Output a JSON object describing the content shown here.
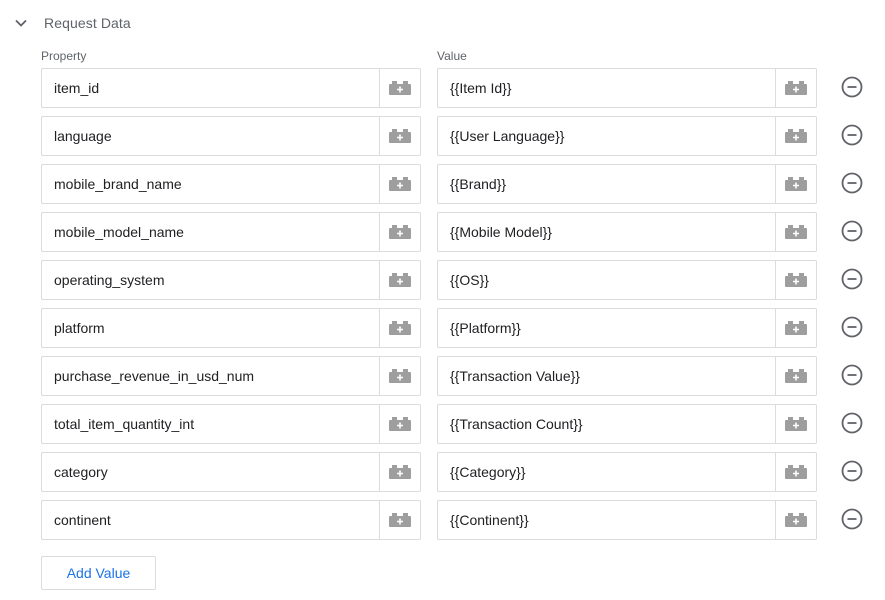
{
  "section": {
    "title": "Request Data",
    "expanded": true
  },
  "columns": {
    "property": "Property",
    "value": "Value"
  },
  "rows": [
    {
      "property": "item_id",
      "value": "{{Item Id}}"
    },
    {
      "property": "language",
      "value": "{{User Language}}"
    },
    {
      "property": "mobile_brand_name",
      "value": "{{Brand}}"
    },
    {
      "property": "mobile_model_name",
      "value": "{{Mobile Model}}"
    },
    {
      "property": "operating_system",
      "value": "{{OS}}"
    },
    {
      "property": "platform",
      "value": "{{Platform}}"
    },
    {
      "property": "purchase_revenue_in_usd_num",
      "value": "{{Transaction Value}}"
    },
    {
      "property": "total_item_quantity_int",
      "value": "{{Transaction Count}}"
    },
    {
      "property": "category",
      "value": "{{Category}}"
    },
    {
      "property": "continent",
      "value": "{{Continent}}"
    }
  ],
  "icons": {
    "collapse": "chevron-down-icon",
    "variable": "add-variable-icon",
    "remove": "remove-circle-icon"
  },
  "add_button": {
    "label": "Add Value"
  },
  "colors": {
    "accent": "#1a73e8",
    "border": "#dadce0",
    "icon": "#9e9e9e",
    "muted": "#5f6368",
    "text": "#202124"
  }
}
